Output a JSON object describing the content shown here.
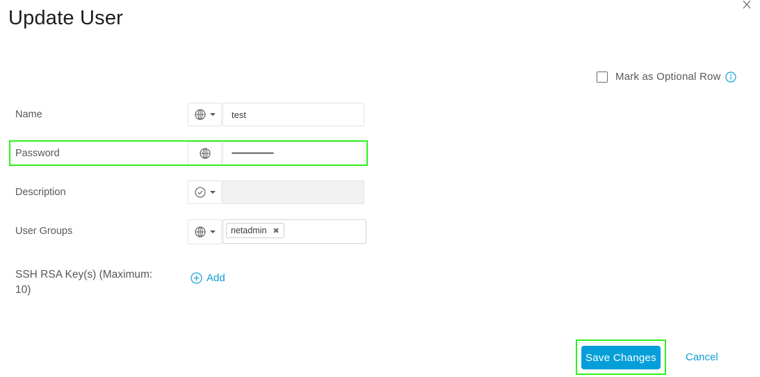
{
  "dialog": {
    "title": "Update User",
    "close_icon": "close-icon"
  },
  "optional_row": {
    "label": "Mark as Optional Row",
    "checked": false,
    "info_icon": "info-icon"
  },
  "form": {
    "name": {
      "label": "Name",
      "scope_icon": "globe-icon",
      "value": "test"
    },
    "password": {
      "label": "Password",
      "scope_icon": "globe-icon",
      "value": "••••••••••••••••••••••••••••••••••••••••••••••••••••"
    },
    "description": {
      "label": "Description",
      "scope_icon": "check-circle-icon",
      "value": ""
    },
    "user_groups": {
      "label": "User Groups",
      "scope_icon": "globe-icon",
      "tags": [
        "netadmin"
      ]
    },
    "ssh_keys": {
      "label": "SSH RSA Key(s) (Maximum: 10)",
      "add_label": "Add",
      "add_icon": "plus-circle-icon"
    }
  },
  "footer": {
    "save_label": "Save Changes",
    "cancel_label": "Cancel"
  },
  "colors": {
    "accent": "#049fd9",
    "link": "#0d9ed8",
    "highlight": "#2ef01e"
  }
}
